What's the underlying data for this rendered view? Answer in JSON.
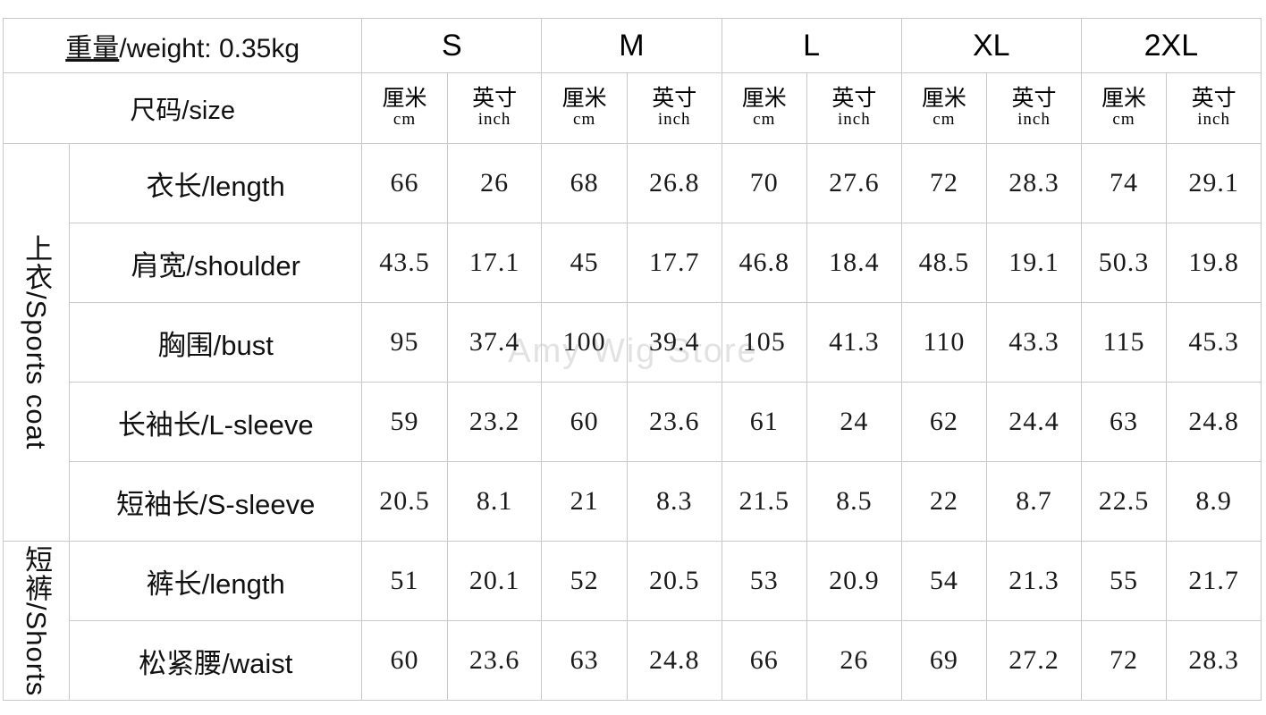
{
  "watermark": "Amy Wig Store",
  "header": {
    "weight_label_cn": "重量",
    "weight_label_rest": "/weight: 0.35kg",
    "size_label": "尺码/size",
    "unit_cm_cn": "厘米",
    "unit_cm_en": "cm",
    "unit_inch_cn": "英寸",
    "unit_inch_en": "inch",
    "sizes": [
      "S",
      "M",
      "L",
      "XL",
      "2XL"
    ]
  },
  "groups": [
    {
      "label": "上衣/Sports coat",
      "rows": [
        {
          "measure": "衣长/length",
          "values": [
            "66",
            "26",
            "68",
            "26.8",
            "70",
            "27.6",
            "72",
            "28.3",
            "74",
            "29.1"
          ]
        },
        {
          "measure": "肩宽/shoulder",
          "values": [
            "43.5",
            "17.1",
            "45",
            "17.7",
            "46.8",
            "18.4",
            "48.5",
            "19.1",
            "50.3",
            "19.8"
          ]
        },
        {
          "measure": "胸围/bust",
          "values": [
            "95",
            "37.4",
            "100",
            "39.4",
            "105",
            "41.3",
            "110",
            "43.3",
            "115",
            "45.3"
          ]
        },
        {
          "measure": "长袖长/L-sleeve",
          "values": [
            "59",
            "23.2",
            "60",
            "23.6",
            "61",
            "24",
            "62",
            "24.4",
            "63",
            "24.8"
          ]
        },
        {
          "measure": "短袖长/S-sleeve",
          "values": [
            "20.5",
            "8.1",
            "21",
            "8.3",
            "21.5",
            "8.5",
            "22",
            "8.7",
            "22.5",
            "8.9"
          ]
        }
      ]
    },
    {
      "label": "短裤/Shorts",
      "rows": [
        {
          "measure": "裤长/length",
          "values": [
            "51",
            "20.1",
            "52",
            "20.5",
            "53",
            "20.9",
            "54",
            "21.3",
            "55",
            "21.7"
          ]
        },
        {
          "measure": "松紧腰/waist",
          "values": [
            "60",
            "23.6",
            "63",
            "24.8",
            "66",
            "26",
            "69",
            "27.2",
            "72",
            "28.3"
          ]
        }
      ]
    }
  ],
  "chart_data": {
    "type": "table",
    "title": "重量/weight: 0.35kg",
    "columns": [
      "尺码/size",
      "S 厘米 cm",
      "S 英寸 inch",
      "M 厘米 cm",
      "M 英寸 inch",
      "L 厘米 cm",
      "L 英寸 inch",
      "XL 厘米 cm",
      "XL 英寸 inch",
      "2XL 厘米 cm",
      "2XL 英寸 inch"
    ],
    "rows": [
      [
        "上衣/Sports coat - 衣长/length",
        66,
        26,
        68,
        26.8,
        70,
        27.6,
        72,
        28.3,
        74,
        29.1
      ],
      [
        "上衣/Sports coat - 肩宽/shoulder",
        43.5,
        17.1,
        45,
        17.7,
        46.8,
        18.4,
        48.5,
        19.1,
        50.3,
        19.8
      ],
      [
        "上衣/Sports coat - 胸围/bust",
        95,
        37.4,
        100,
        39.4,
        105,
        41.3,
        110,
        43.3,
        115,
        45.3
      ],
      [
        "上衣/Sports coat - 长袖长/L-sleeve",
        59,
        23.2,
        60,
        23.6,
        61,
        24,
        62,
        24.4,
        63,
        24.8
      ],
      [
        "上衣/Sports coat - 短袖长/S-sleeve",
        20.5,
        8.1,
        21,
        8.3,
        21.5,
        8.5,
        22,
        8.7,
        22.5,
        8.9
      ],
      [
        "短裤/Shorts - 裤长/length",
        51,
        20.1,
        52,
        20.5,
        53,
        20.9,
        54,
        21.3,
        55,
        21.7
      ],
      [
        "短裤/Shorts - 松紧腰/waist",
        60,
        23.6,
        63,
        24.8,
        66,
        26,
        69,
        27.2,
        72,
        28.3
      ]
    ]
  }
}
